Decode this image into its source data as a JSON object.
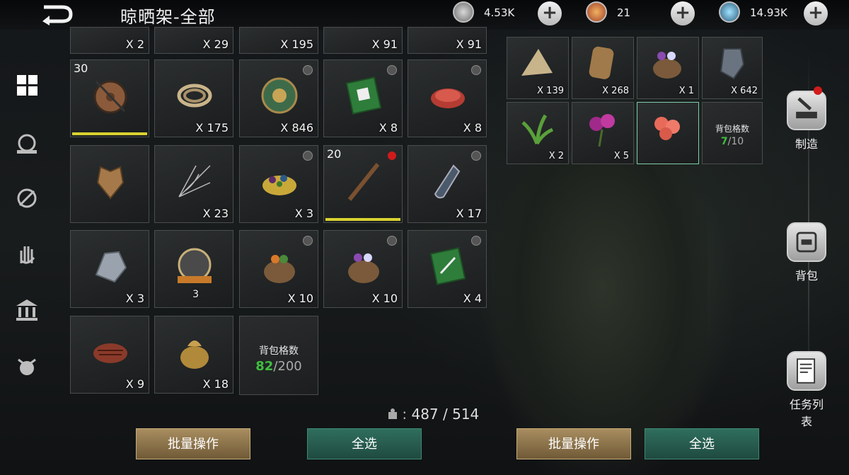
{
  "header": {
    "title": "晾晒架-全部"
  },
  "currencies": [
    {
      "icon": "silver-coin-icon",
      "value": "4.53K"
    },
    {
      "icon": "gold-medal-icon",
      "value": "21"
    },
    {
      "icon": "crystal-gem-icon",
      "value": "14.93K"
    }
  ],
  "left_grid": {
    "top_partial_qty": [
      "X 2",
      "X 29",
      "X 195",
      "X 91",
      "X 91"
    ],
    "slots": [
      {
        "icon": "shield-icon",
        "level": "30",
        "qty": "",
        "bar": 1.0,
        "locked": false,
        "dot": false
      },
      {
        "icon": "rope-bundle-icon",
        "level": "",
        "qty": "X 175",
        "locked": false,
        "dot": false
      },
      {
        "icon": "ornate-orb-icon",
        "level": "",
        "qty": "X 846",
        "locked": true,
        "dot": false
      },
      {
        "icon": "green-book-icon",
        "level": "",
        "qty": "X 8",
        "locked": true,
        "dot": false
      },
      {
        "icon": "raw-meat-icon",
        "level": "",
        "qty": "X 8",
        "locked": true,
        "dot": false
      },
      {
        "icon": "golden-armor-icon",
        "level": "",
        "qty": "",
        "locked": false,
        "dot": false
      },
      {
        "icon": "spider-web-icon",
        "level": "",
        "qty": "X 23",
        "locked": false,
        "dot": false
      },
      {
        "icon": "berries-pile-icon",
        "level": "",
        "qty": "X 3",
        "locked": true,
        "dot": false
      },
      {
        "icon": "wooden-staff-icon",
        "level": "20",
        "qty": "",
        "bar": 1.0,
        "locked": false,
        "dot": true
      },
      {
        "icon": "glass-vial-icon",
        "level": "",
        "qty": "X 17",
        "locked": true,
        "dot": false
      },
      {
        "icon": "silver-ore-icon",
        "level": "",
        "qty": "X 3",
        "locked": false,
        "dot": false
      },
      {
        "icon": "dragon-medallion-icon",
        "level": "",
        "qty": "3",
        "locked": false,
        "dot": false
      },
      {
        "icon": "vegetable-sack-icon",
        "level": "",
        "qty": "X 10",
        "locked": true,
        "dot": false
      },
      {
        "icon": "flower-sack-icon",
        "level": "",
        "qty": "X 10",
        "locked": true,
        "dot": false
      },
      {
        "icon": "green-book-sword-icon",
        "level": "",
        "qty": "X 4",
        "locked": true,
        "dot": false
      },
      {
        "icon": "grilled-steak-icon",
        "level": "",
        "qty": "X 9",
        "locked": false,
        "dot": false
      },
      {
        "icon": "gold-pouch-icon",
        "level": "",
        "qty": "X 18",
        "locked": false,
        "dot": false
      }
    ],
    "capacity": {
      "label": "背包格数",
      "used": "82",
      "total": "/200"
    }
  },
  "right_grid": {
    "slots": [
      {
        "icon": "fern-leaf-icon",
        "qty": "X 139"
      },
      {
        "icon": "snake-skin-icon",
        "qty": "X 268"
      },
      {
        "icon": "flower-basket-icon",
        "qty": "X 1"
      },
      {
        "icon": "iron-gauntlet-icon",
        "qty": "X 642"
      },
      {
        "icon": "green-herb-icon",
        "qty": "X 2"
      },
      {
        "icon": "purple-orchid-icon",
        "qty": "X 5"
      },
      {
        "icon": "red-poppy-icon",
        "qty": ""
      }
    ],
    "capacity": {
      "label": "背包格数",
      "used": "7",
      "total": "/10"
    }
  },
  "storage_count": {
    "current": "487",
    "max": "514"
  },
  "buttons": {
    "batch_left": "批量操作",
    "select_all_left": "全选",
    "batch_right": "批量操作",
    "select_all_right": "全选"
  },
  "side_actions": [
    {
      "icon": "anvil-hammer-icon",
      "label": "制造"
    },
    {
      "icon": "backpack-icon",
      "label": "背包"
    },
    {
      "icon": "quest-scroll-icon",
      "label": "任务列表"
    }
  ],
  "colors": {
    "accent_gold": "#a88d5f",
    "accent_green": "#2f6e5d",
    "capacity_green": "#3fbf3f",
    "notify_red": "#d01b1b"
  }
}
